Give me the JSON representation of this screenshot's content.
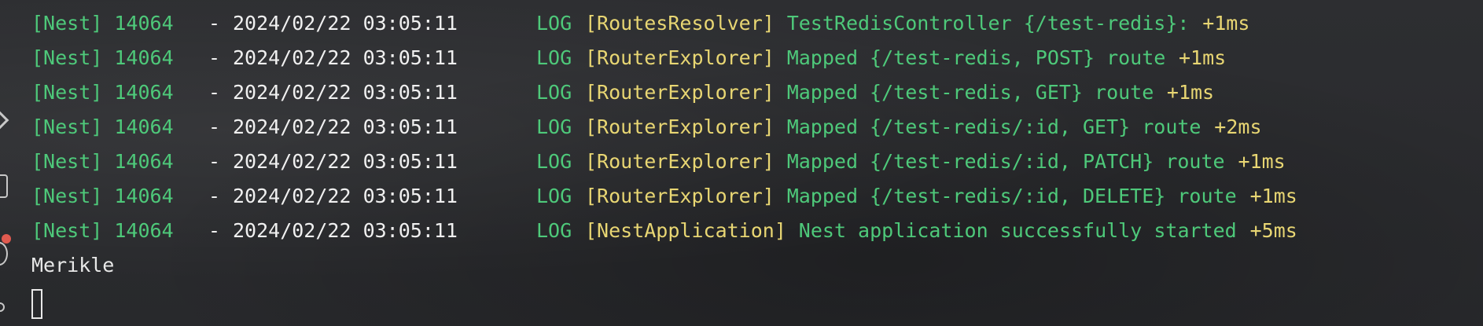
{
  "log_lines": [
    {
      "app": "[Nest] 14064",
      "dash": "-",
      "datetime": "2024/02/22 03:05:11",
      "level": "LOG",
      "context": "[RoutesResolver]",
      "message": "TestRedisController {/test-redis}:",
      "timing": "+1ms"
    },
    {
      "app": "[Nest] 14064",
      "dash": "-",
      "datetime": "2024/02/22 03:05:11",
      "level": "LOG",
      "context": "[RouterExplorer]",
      "message": "Mapped {/test-redis, POST} route",
      "timing": "+1ms"
    },
    {
      "app": "[Nest] 14064",
      "dash": "-",
      "datetime": "2024/02/22 03:05:11",
      "level": "LOG",
      "context": "[RouterExplorer]",
      "message": "Mapped {/test-redis, GET} route",
      "timing": "+1ms"
    },
    {
      "app": "[Nest] 14064",
      "dash": "-",
      "datetime": "2024/02/22 03:05:11",
      "level": "LOG",
      "context": "[RouterExplorer]",
      "message": "Mapped {/test-redis/:id, GET} route",
      "timing": "+2ms"
    },
    {
      "app": "[Nest] 14064",
      "dash": "-",
      "datetime": "2024/02/22 03:05:11",
      "level": "LOG",
      "context": "[RouterExplorer]",
      "message": "Mapped {/test-redis/:id, PATCH} route",
      "timing": "+1ms"
    },
    {
      "app": "[Nest] 14064",
      "dash": "-",
      "datetime": "2024/02/22 03:05:11",
      "level": "LOG",
      "context": "[RouterExplorer]",
      "message": "Mapped {/test-redis/:id, DELETE} route",
      "timing": "+1ms"
    },
    {
      "app": "[Nest] 14064",
      "dash": "-",
      "datetime": "2024/02/22 03:05:11",
      "level": "LOG",
      "context": "[NestApplication]",
      "message": "Nest application successfully started",
      "timing": "+5ms"
    }
  ],
  "output_text": "Merikle",
  "colors": {
    "green": "#4ec97a",
    "white": "#f0f0f0",
    "yellow": "#e8d673",
    "background": "#2a2b2e"
  },
  "icons": [
    "chevron-right-icon",
    "terminal-box-icon",
    "record-dot-icon",
    "arc-icon",
    "link-icon"
  ]
}
